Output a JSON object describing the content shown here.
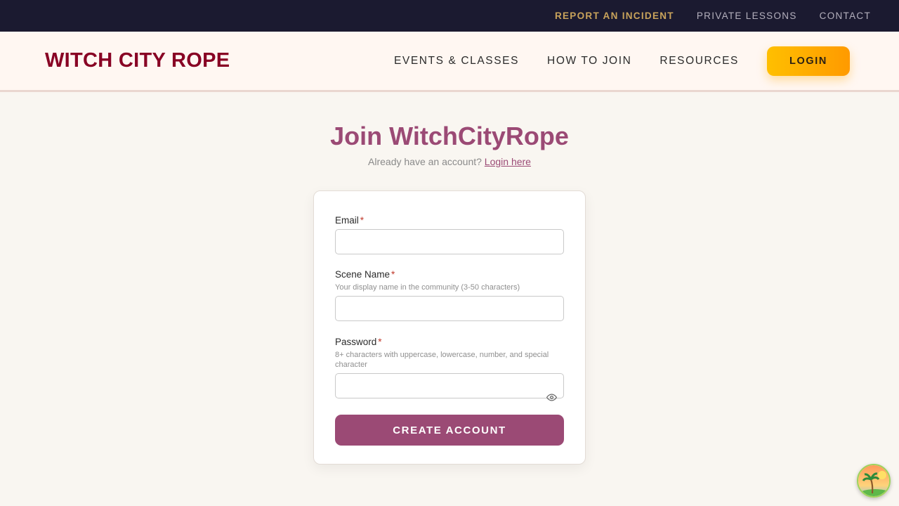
{
  "utility_nav": {
    "items": [
      {
        "label": "REPORT AN INCIDENT"
      },
      {
        "label": "PRIVATE LESSONS"
      },
      {
        "label": "CONTACT"
      }
    ]
  },
  "header": {
    "logo": "WITCH CITY ROPE",
    "nav": [
      {
        "label": "EVENTS & CLASSES"
      },
      {
        "label": "HOW TO JOIN"
      },
      {
        "label": "RESOURCES"
      }
    ],
    "login_label": "LOGIN"
  },
  "page": {
    "title": "Join WitchCityRope",
    "subtitle_text": "Already have an account?",
    "subtitle_link": "Login here"
  },
  "form": {
    "email": {
      "label": "Email",
      "required_mark": "*",
      "value": "",
      "placeholder": ""
    },
    "scene_name": {
      "label": "Scene Name",
      "required_mark": "*",
      "help": "Your display name in the community (3-50 characters)",
      "value": "",
      "placeholder": ""
    },
    "password": {
      "label": "Password",
      "required_mark": "*",
      "help": "8+ characters with uppercase, lowercase, number, and special character",
      "value": "",
      "placeholder": ""
    },
    "submit_label": "CREATE ACCOUNT"
  },
  "icons": {
    "password_toggle": "eye-icon",
    "corner_widget": "palm-tree-sunset-icon"
  },
  "colors": {
    "utility_bg": "#1b1a30",
    "incident_link": "#c9a35b",
    "brand_red": "#880124",
    "accent_plum": "#9b4a75",
    "login_gradient_start": "#ffbf00",
    "login_gradient_end": "#ff9a00",
    "page_bg": "#f9f6f1"
  }
}
